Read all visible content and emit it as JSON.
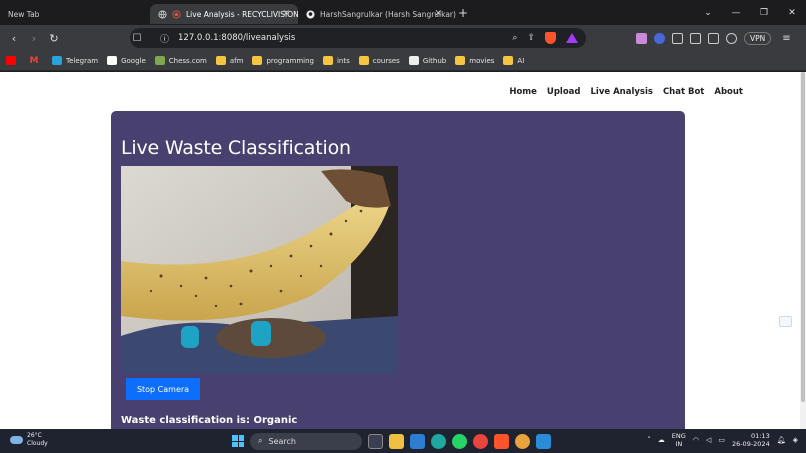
{
  "browser": {
    "tabs": [
      {
        "label": "New Tab",
        "active": false
      },
      {
        "label": "Live Analysis - RECYCLIVISION",
        "active": true
      },
      {
        "label": "HarshSangrulkar (Harsh Sangrulkar)",
        "active": false
      }
    ],
    "new_tab_symbol": "+",
    "url": "127.0.0.1:8080/liveanalysis",
    "vpn_label": "VPN",
    "bookmarks": [
      {
        "label": "",
        "icon": "youtube-icon"
      },
      {
        "label": "",
        "icon": "gmail-icon"
      },
      {
        "label": "Telegram",
        "icon": "telegram-icon"
      },
      {
        "label": "Google",
        "icon": "google-icon"
      },
      {
        "label": "Chess.com",
        "icon": "chess-icon"
      },
      {
        "label": "afm",
        "icon": "folder-icon"
      },
      {
        "label": "programming",
        "icon": "folder-icon"
      },
      {
        "label": "ints",
        "icon": "folder-icon"
      },
      {
        "label": "courses",
        "icon": "folder-icon"
      },
      {
        "label": "Github",
        "icon": "github-icon"
      },
      {
        "label": "movies",
        "icon": "folder-icon"
      },
      {
        "label": "AI",
        "icon": "folder-icon"
      }
    ]
  },
  "site": {
    "nav": [
      "Home",
      "Upload",
      "Live Analysis",
      "Chat Bot",
      "About"
    ],
    "heading": "Live Waste Classification",
    "stop_button": "Stop Camera",
    "result": "Waste classification is: Organic"
  },
  "taskbar": {
    "temperature": "26°C",
    "weather": "Cloudy",
    "search": "Search",
    "lang_top": "ENG",
    "lang_bottom": "IN",
    "time": "01:13",
    "date": "26-09-2024"
  },
  "colors": {
    "card_bg": "#48406f",
    "button": "#0d6efd",
    "tab_bar": "#1c1c1f",
    "toolbar": "#3a3b3f"
  }
}
